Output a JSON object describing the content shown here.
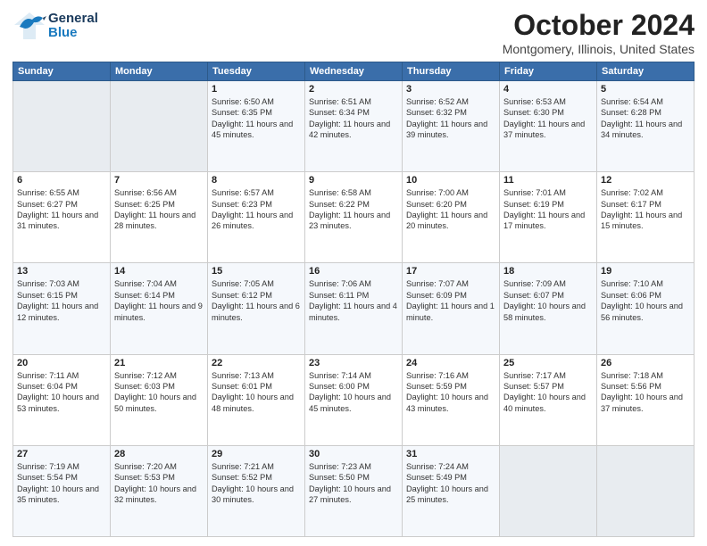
{
  "header": {
    "logo_general": "General",
    "logo_blue": "Blue",
    "title": "October 2024",
    "subtitle": "Montgomery, Illinois, United States"
  },
  "days_of_week": [
    "Sunday",
    "Monday",
    "Tuesday",
    "Wednesday",
    "Thursday",
    "Friday",
    "Saturday"
  ],
  "weeks": [
    [
      {
        "num": "",
        "sunrise": "",
        "sunset": "",
        "daylight": "",
        "empty": true
      },
      {
        "num": "",
        "sunrise": "",
        "sunset": "",
        "daylight": "",
        "empty": true
      },
      {
        "num": "1",
        "sunrise": "Sunrise: 6:50 AM",
        "sunset": "Sunset: 6:35 PM",
        "daylight": "Daylight: 11 hours and 45 minutes.",
        "empty": false
      },
      {
        "num": "2",
        "sunrise": "Sunrise: 6:51 AM",
        "sunset": "Sunset: 6:34 PM",
        "daylight": "Daylight: 11 hours and 42 minutes.",
        "empty": false
      },
      {
        "num": "3",
        "sunrise": "Sunrise: 6:52 AM",
        "sunset": "Sunset: 6:32 PM",
        "daylight": "Daylight: 11 hours and 39 minutes.",
        "empty": false
      },
      {
        "num": "4",
        "sunrise": "Sunrise: 6:53 AM",
        "sunset": "Sunset: 6:30 PM",
        "daylight": "Daylight: 11 hours and 37 minutes.",
        "empty": false
      },
      {
        "num": "5",
        "sunrise": "Sunrise: 6:54 AM",
        "sunset": "Sunset: 6:28 PM",
        "daylight": "Daylight: 11 hours and 34 minutes.",
        "empty": false
      }
    ],
    [
      {
        "num": "6",
        "sunrise": "Sunrise: 6:55 AM",
        "sunset": "Sunset: 6:27 PM",
        "daylight": "Daylight: 11 hours and 31 minutes.",
        "empty": false
      },
      {
        "num": "7",
        "sunrise": "Sunrise: 6:56 AM",
        "sunset": "Sunset: 6:25 PM",
        "daylight": "Daylight: 11 hours and 28 minutes.",
        "empty": false
      },
      {
        "num": "8",
        "sunrise": "Sunrise: 6:57 AM",
        "sunset": "Sunset: 6:23 PM",
        "daylight": "Daylight: 11 hours and 26 minutes.",
        "empty": false
      },
      {
        "num": "9",
        "sunrise": "Sunrise: 6:58 AM",
        "sunset": "Sunset: 6:22 PM",
        "daylight": "Daylight: 11 hours and 23 minutes.",
        "empty": false
      },
      {
        "num": "10",
        "sunrise": "Sunrise: 7:00 AM",
        "sunset": "Sunset: 6:20 PM",
        "daylight": "Daylight: 11 hours and 20 minutes.",
        "empty": false
      },
      {
        "num": "11",
        "sunrise": "Sunrise: 7:01 AM",
        "sunset": "Sunset: 6:19 PM",
        "daylight": "Daylight: 11 hours and 17 minutes.",
        "empty": false
      },
      {
        "num": "12",
        "sunrise": "Sunrise: 7:02 AM",
        "sunset": "Sunset: 6:17 PM",
        "daylight": "Daylight: 11 hours and 15 minutes.",
        "empty": false
      }
    ],
    [
      {
        "num": "13",
        "sunrise": "Sunrise: 7:03 AM",
        "sunset": "Sunset: 6:15 PM",
        "daylight": "Daylight: 11 hours and 12 minutes.",
        "empty": false
      },
      {
        "num": "14",
        "sunrise": "Sunrise: 7:04 AM",
        "sunset": "Sunset: 6:14 PM",
        "daylight": "Daylight: 11 hours and 9 minutes.",
        "empty": false
      },
      {
        "num": "15",
        "sunrise": "Sunrise: 7:05 AM",
        "sunset": "Sunset: 6:12 PM",
        "daylight": "Daylight: 11 hours and 6 minutes.",
        "empty": false
      },
      {
        "num": "16",
        "sunrise": "Sunrise: 7:06 AM",
        "sunset": "Sunset: 6:11 PM",
        "daylight": "Daylight: 11 hours and 4 minutes.",
        "empty": false
      },
      {
        "num": "17",
        "sunrise": "Sunrise: 7:07 AM",
        "sunset": "Sunset: 6:09 PM",
        "daylight": "Daylight: 11 hours and 1 minute.",
        "empty": false
      },
      {
        "num": "18",
        "sunrise": "Sunrise: 7:09 AM",
        "sunset": "Sunset: 6:07 PM",
        "daylight": "Daylight: 10 hours and 58 minutes.",
        "empty": false
      },
      {
        "num": "19",
        "sunrise": "Sunrise: 7:10 AM",
        "sunset": "Sunset: 6:06 PM",
        "daylight": "Daylight: 10 hours and 56 minutes.",
        "empty": false
      }
    ],
    [
      {
        "num": "20",
        "sunrise": "Sunrise: 7:11 AM",
        "sunset": "Sunset: 6:04 PM",
        "daylight": "Daylight: 10 hours and 53 minutes.",
        "empty": false
      },
      {
        "num": "21",
        "sunrise": "Sunrise: 7:12 AM",
        "sunset": "Sunset: 6:03 PM",
        "daylight": "Daylight: 10 hours and 50 minutes.",
        "empty": false
      },
      {
        "num": "22",
        "sunrise": "Sunrise: 7:13 AM",
        "sunset": "Sunset: 6:01 PM",
        "daylight": "Daylight: 10 hours and 48 minutes.",
        "empty": false
      },
      {
        "num": "23",
        "sunrise": "Sunrise: 7:14 AM",
        "sunset": "Sunset: 6:00 PM",
        "daylight": "Daylight: 10 hours and 45 minutes.",
        "empty": false
      },
      {
        "num": "24",
        "sunrise": "Sunrise: 7:16 AM",
        "sunset": "Sunset: 5:59 PM",
        "daylight": "Daylight: 10 hours and 43 minutes.",
        "empty": false
      },
      {
        "num": "25",
        "sunrise": "Sunrise: 7:17 AM",
        "sunset": "Sunset: 5:57 PM",
        "daylight": "Daylight: 10 hours and 40 minutes.",
        "empty": false
      },
      {
        "num": "26",
        "sunrise": "Sunrise: 7:18 AM",
        "sunset": "Sunset: 5:56 PM",
        "daylight": "Daylight: 10 hours and 37 minutes.",
        "empty": false
      }
    ],
    [
      {
        "num": "27",
        "sunrise": "Sunrise: 7:19 AM",
        "sunset": "Sunset: 5:54 PM",
        "daylight": "Daylight: 10 hours and 35 minutes.",
        "empty": false
      },
      {
        "num": "28",
        "sunrise": "Sunrise: 7:20 AM",
        "sunset": "Sunset: 5:53 PM",
        "daylight": "Daylight: 10 hours and 32 minutes.",
        "empty": false
      },
      {
        "num": "29",
        "sunrise": "Sunrise: 7:21 AM",
        "sunset": "Sunset: 5:52 PM",
        "daylight": "Daylight: 10 hours and 30 minutes.",
        "empty": false
      },
      {
        "num": "30",
        "sunrise": "Sunrise: 7:23 AM",
        "sunset": "Sunset: 5:50 PM",
        "daylight": "Daylight: 10 hours and 27 minutes.",
        "empty": false
      },
      {
        "num": "31",
        "sunrise": "Sunrise: 7:24 AM",
        "sunset": "Sunset: 5:49 PM",
        "daylight": "Daylight: 10 hours and 25 minutes.",
        "empty": false
      },
      {
        "num": "",
        "sunrise": "",
        "sunset": "",
        "daylight": "",
        "empty": true
      },
      {
        "num": "",
        "sunrise": "",
        "sunset": "",
        "daylight": "",
        "empty": true
      }
    ]
  ]
}
